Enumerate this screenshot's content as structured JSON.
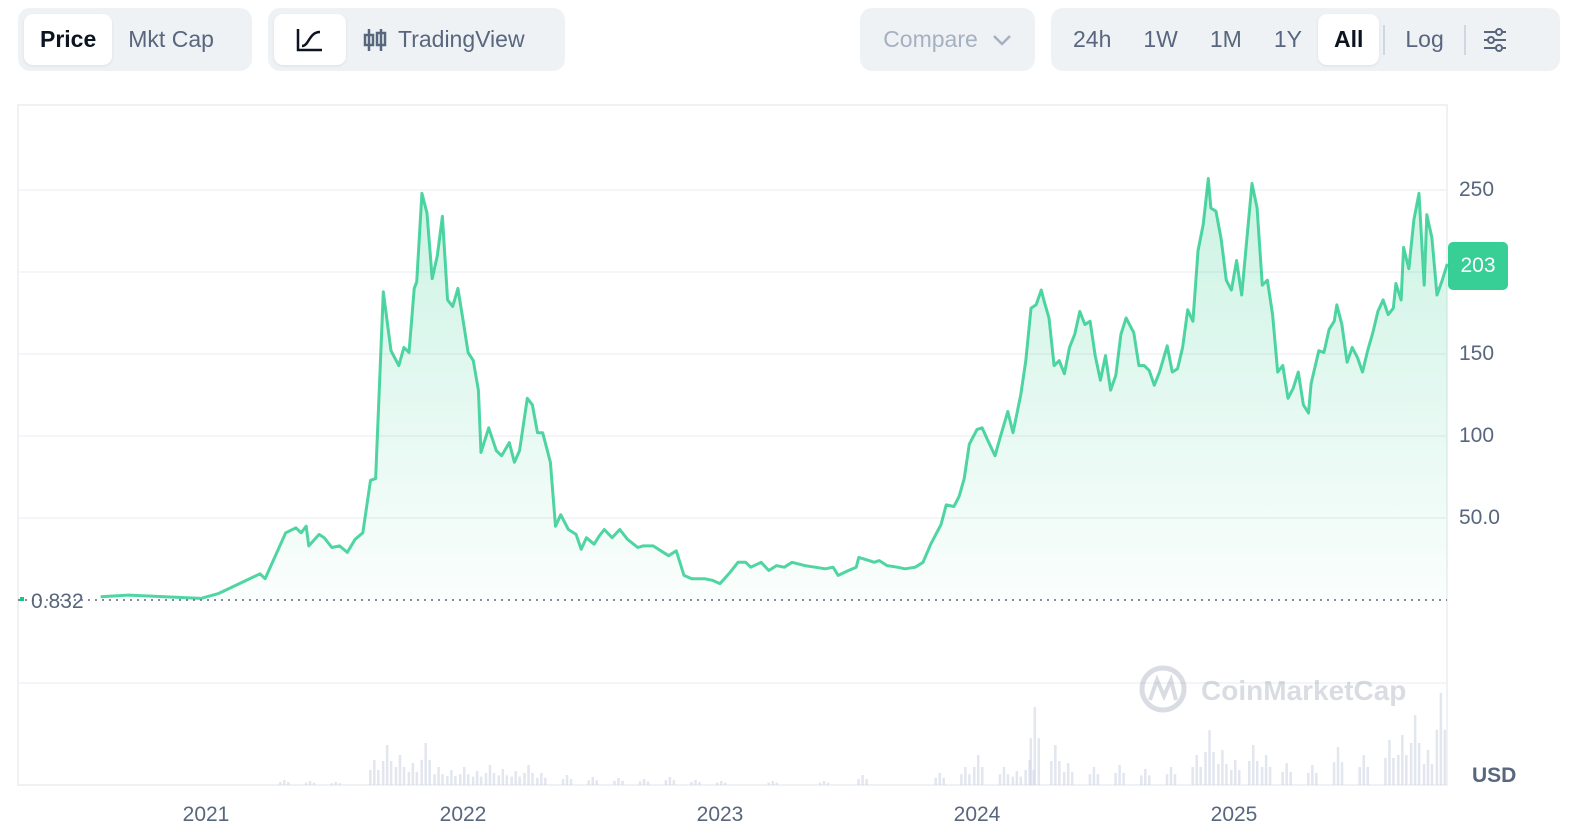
{
  "toolbar": {
    "metric_tabs": [
      "Price",
      "Mkt Cap"
    ],
    "chart_type": {
      "line_icon": "line-chart-icon",
      "tradingview_icon": "candlestick-icon",
      "tradingview_label": "TradingView"
    },
    "compare_label": "Compare",
    "ranges": [
      "24h",
      "1W",
      "1M",
      "1Y",
      "All"
    ],
    "log_label": "Log",
    "settings_icon": "sliders-icon"
  },
  "chart_data": {
    "type": "line",
    "title": "",
    "xlabel": "",
    "ylabel": "USD",
    "currency": "USD",
    "x_ticks": [
      "2021",
      "2022",
      "2023",
      "2024",
      "2025"
    ],
    "y_ticks": [
      "250",
      "150",
      "100",
      "50.0"
    ],
    "ylim": [
      0,
      250
    ],
    "start_price_label": "0.832",
    "current_price_label": "203",
    "watermark": "CoinMarketCap",
    "line_color": "#16c784",
    "series": [
      {
        "name": "Price",
        "points": [
          [
            2020.59,
            2
          ],
          [
            2020.7,
            3
          ],
          [
            2020.98,
            1
          ],
          [
            2021.05,
            4
          ],
          [
            2021.13,
            10
          ],
          [
            2021.21,
            16
          ],
          [
            2021.23,
            13
          ],
          [
            2021.27,
            27
          ],
          [
            2021.31,
            41
          ],
          [
            2021.35,
            44
          ],
          [
            2021.37,
            41
          ],
          [
            2021.39,
            45
          ],
          [
            2021.4,
            33
          ],
          [
            2021.44,
            40
          ],
          [
            2021.46,
            38
          ],
          [
            2021.49,
            32
          ],
          [
            2021.52,
            33
          ],
          [
            2021.55,
            29
          ],
          [
            2021.58,
            37
          ],
          [
            2021.61,
            41
          ],
          [
            2021.64,
            73
          ],
          [
            2021.66,
            74
          ],
          [
            2021.69,
            188
          ],
          [
            2021.72,
            152
          ],
          [
            2021.75,
            143
          ],
          [
            2021.77,
            154
          ],
          [
            2021.79,
            151
          ],
          [
            2021.81,
            190
          ],
          [
            2021.82,
            194
          ],
          [
            2021.84,
            248
          ],
          [
            2021.86,
            236
          ],
          [
            2021.88,
            196
          ],
          [
            2021.9,
            210
          ],
          [
            2021.92,
            234
          ],
          [
            2021.94,
            183
          ],
          [
            2021.96,
            179
          ],
          [
            2021.98,
            190
          ],
          [
            2022.0,
            171
          ],
          [
            2022.02,
            151
          ],
          [
            2022.04,
            146
          ],
          [
            2022.06,
            128
          ],
          [
            2022.07,
            90
          ],
          [
            2022.1,
            105
          ],
          [
            2022.13,
            91
          ],
          [
            2022.15,
            88
          ],
          [
            2022.18,
            96
          ],
          [
            2022.2,
            84
          ],
          [
            2022.22,
            91
          ],
          [
            2022.25,
            123
          ],
          [
            2022.27,
            119
          ],
          [
            2022.29,
            102
          ],
          [
            2022.31,
            102
          ],
          [
            2022.34,
            84
          ],
          [
            2022.36,
            45
          ],
          [
            2022.38,
            52
          ],
          [
            2022.41,
            43
          ],
          [
            2022.44,
            40
          ],
          [
            2022.46,
            31
          ],
          [
            2022.48,
            38
          ],
          [
            2022.51,
            34
          ],
          [
            2022.53,
            39
          ],
          [
            2022.55,
            43
          ],
          [
            2022.58,
            38
          ],
          [
            2022.61,
            43
          ],
          [
            2022.64,
            37
          ],
          [
            2022.68,
            32
          ],
          [
            2022.7,
            33
          ],
          [
            2022.74,
            33
          ],
          [
            2022.77,
            30
          ],
          [
            2022.8,
            27
          ],
          [
            2022.83,
            30
          ],
          [
            2022.86,
            15
          ],
          [
            2022.89,
            13
          ],
          [
            2022.94,
            13
          ],
          [
            2022.97,
            12
          ],
          [
            2023.0,
            10
          ],
          [
            2023.04,
            17
          ],
          [
            2023.07,
            23
          ],
          [
            2023.1,
            23
          ],
          [
            2023.12,
            20
          ],
          [
            2023.16,
            23
          ],
          [
            2023.19,
            18
          ],
          [
            2023.22,
            21
          ],
          [
            2023.25,
            20
          ],
          [
            2023.28,
            23
          ],
          [
            2023.33,
            21
          ],
          [
            2023.37,
            20
          ],
          [
            2023.41,
            19
          ],
          [
            2023.44,
            20
          ],
          [
            2023.46,
            15
          ],
          [
            2023.5,
            18
          ],
          [
            2023.53,
            20
          ],
          [
            2023.54,
            26
          ],
          [
            2023.58,
            24
          ],
          [
            2023.6,
            23
          ],
          [
            2023.62,
            24
          ],
          [
            2023.65,
            21
          ],
          [
            2023.69,
            20
          ],
          [
            2023.72,
            19
          ],
          [
            2023.76,
            20
          ],
          [
            2023.79,
            23
          ],
          [
            2023.82,
            34
          ],
          [
            2023.86,
            46
          ],
          [
            2023.88,
            58
          ],
          [
            2023.91,
            57
          ],
          [
            2023.93,
            63
          ],
          [
            2023.95,
            74
          ],
          [
            2023.97,
            95
          ],
          [
            2024.0,
            104
          ],
          [
            2024.02,
            105
          ],
          [
            2024.04,
            98
          ],
          [
            2024.07,
            88
          ],
          [
            2024.09,
            99
          ],
          [
            2024.12,
            115
          ],
          [
            2024.14,
            102
          ],
          [
            2024.17,
            125
          ],
          [
            2024.19,
            146
          ],
          [
            2024.21,
            178
          ],
          [
            2024.23,
            180
          ],
          [
            2024.25,
            189
          ],
          [
            2024.26,
            183
          ],
          [
            2024.28,
            172
          ],
          [
            2024.3,
            143
          ],
          [
            2024.32,
            146
          ],
          [
            2024.34,
            138
          ],
          [
            2024.36,
            154
          ],
          [
            2024.38,
            162
          ],
          [
            2024.4,
            176
          ],
          [
            2024.42,
            168
          ],
          [
            2024.44,
            170
          ],
          [
            2024.46,
            149
          ],
          [
            2024.48,
            134
          ],
          [
            2024.5,
            149
          ],
          [
            2024.52,
            128
          ],
          [
            2024.54,
            137
          ],
          [
            2024.56,
            162
          ],
          [
            2024.58,
            172
          ],
          [
            2024.61,
            163
          ],
          [
            2024.63,
            143
          ],
          [
            2024.65,
            143
          ],
          [
            2024.67,
            140
          ],
          [
            2024.69,
            131
          ],
          [
            2024.71,
            139
          ],
          [
            2024.74,
            155
          ],
          [
            2024.76,
            139
          ],
          [
            2024.78,
            141
          ],
          [
            2024.8,
            154
          ],
          [
            2024.82,
            177
          ],
          [
            2024.84,
            170
          ],
          [
            2024.86,
            213
          ],
          [
            2024.88,
            229
          ],
          [
            2024.9,
            257
          ],
          [
            2024.91,
            239
          ],
          [
            2024.93,
            237
          ],
          [
            2024.95,
            220
          ],
          [
            2024.97,
            195
          ],
          [
            2024.99,
            189
          ],
          [
            2025.01,
            207
          ],
          [
            2025.03,
            186
          ],
          [
            2025.05,
            220
          ],
          [
            2025.07,
            254
          ],
          [
            2025.09,
            239
          ],
          [
            2025.11,
            192
          ],
          [
            2025.13,
            195
          ],
          [
            2025.15,
            174
          ],
          [
            2025.17,
            139
          ],
          [
            2025.19,
            143
          ],
          [
            2025.21,
            123
          ],
          [
            2025.23,
            129
          ],
          [
            2025.25,
            139
          ],
          [
            2025.27,
            119
          ],
          [
            2025.29,
            114
          ],
          [
            2025.3,
            132
          ],
          [
            2025.33,
            152
          ],
          [
            2025.35,
            151
          ],
          [
            2025.37,
            165
          ],
          [
            2025.39,
            170
          ],
          [
            2025.4,
            180
          ],
          [
            2025.42,
            168
          ],
          [
            2025.44,
            145
          ],
          [
            2025.46,
            154
          ],
          [
            2025.48,
            148
          ],
          [
            2025.5,
            139
          ],
          [
            2025.52,
            152
          ],
          [
            2025.54,
            163
          ],
          [
            2025.56,
            176
          ],
          [
            2025.58,
            183
          ],
          [
            2025.6,
            174
          ],
          [
            2025.62,
            178
          ],
          [
            2025.63,
            193
          ],
          [
            2025.65,
            183
          ],
          [
            2025.66,
            215
          ],
          [
            2025.68,
            202
          ],
          [
            2025.7,
            232
          ],
          [
            2025.72,
            248
          ],
          [
            2025.74,
            192
          ],
          [
            2025.75,
            235
          ],
          [
            2025.77,
            221
          ],
          [
            2025.79,
            186
          ],
          [
            2025.81,
            195
          ],
          [
            2025.83,
            205
          ]
        ]
      }
    ],
    "volume_relative": [
      [
        2021.3,
        5
      ],
      [
        2021.4,
        4
      ],
      [
        2021.5,
        3
      ],
      [
        2021.65,
        25
      ],
      [
        2021.7,
        40
      ],
      [
        2021.75,
        30
      ],
      [
        2021.8,
        22
      ],
      [
        2021.85,
        42
      ],
      [
        2021.9,
        18
      ],
      [
        2021.95,
        15
      ],
      [
        2022.0,
        18
      ],
      [
        2022.05,
        14
      ],
      [
        2022.1,
        20
      ],
      [
        2022.15,
        16
      ],
      [
        2022.2,
        14
      ],
      [
        2022.25,
        20
      ],
      [
        2022.3,
        12
      ],
      [
        2022.4,
        10
      ],
      [
        2022.5,
        8
      ],
      [
        2022.6,
        7
      ],
      [
        2022.7,
        6
      ],
      [
        2022.8,
        8
      ],
      [
        2022.9,
        5
      ],
      [
        2023.0,
        4
      ],
      [
        2023.2,
        4
      ],
      [
        2023.4,
        4
      ],
      [
        2023.55,
        10
      ],
      [
        2023.85,
        12
      ],
      [
        2023.95,
        18
      ],
      [
        2024.0,
        30
      ],
      [
        2024.1,
        18
      ],
      [
        2024.15,
        14
      ],
      [
        2024.2,
        25
      ],
      [
        2024.22,
        78
      ],
      [
        2024.3,
        40
      ],
      [
        2024.35,
        22
      ],
      [
        2024.45,
        18
      ],
      [
        2024.55,
        20
      ],
      [
        2024.65,
        16
      ],
      [
        2024.75,
        18
      ],
      [
        2024.85,
        30
      ],
      [
        2024.9,
        55
      ],
      [
        2024.95,
        35
      ],
      [
        2025.0,
        25
      ],
      [
        2025.07,
        40
      ],
      [
        2025.12,
        30
      ],
      [
        2025.2,
        22
      ],
      [
        2025.3,
        20
      ],
      [
        2025.4,
        38
      ],
      [
        2025.5,
        30
      ],
      [
        2025.6,
        45
      ],
      [
        2025.65,
        50
      ],
      [
        2025.7,
        70
      ],
      [
        2025.75,
        35
      ],
      [
        2025.8,
        92
      ]
    ]
  }
}
